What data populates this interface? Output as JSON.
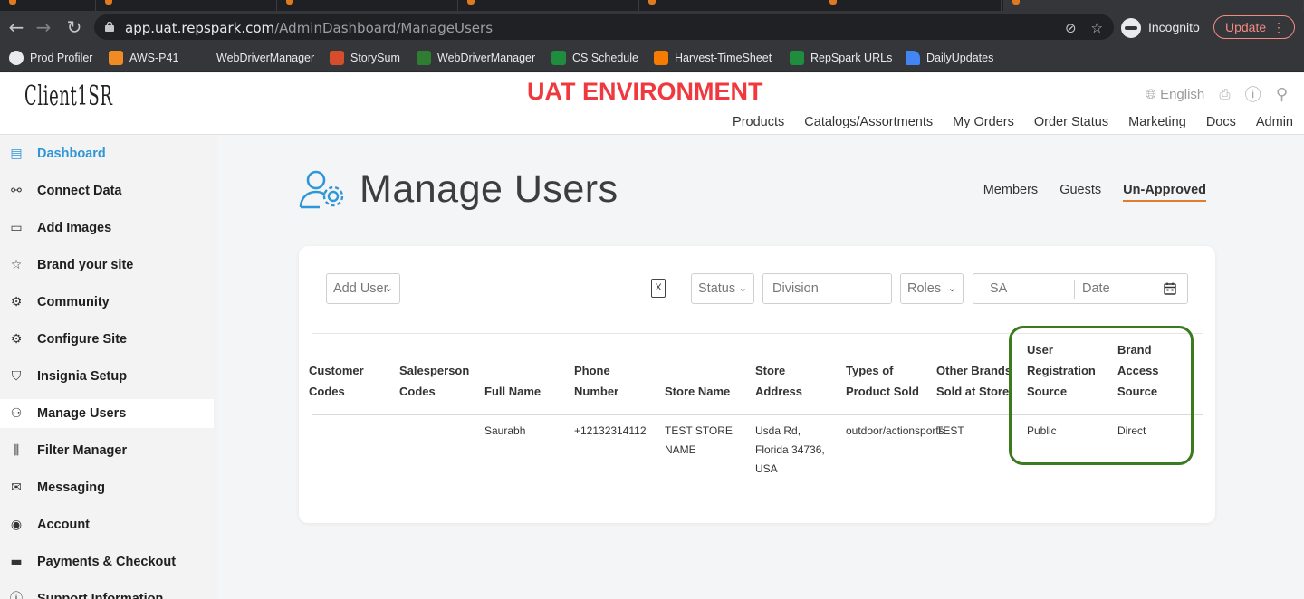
{
  "browser": {
    "url_host": "app.uat.repspark.com",
    "url_path": "/AdminDashboard/ManageUsers",
    "incognito_label": "Incognito",
    "update_label": "Update",
    "bookmarks": [
      {
        "label": "Prod Profiler",
        "color": "#e8eaed"
      },
      {
        "label": "AWS-P41",
        "color": "#f08a24"
      },
      {
        "label": "WebDriverManager",
        "color": "#35363a"
      },
      {
        "label": "StorySum",
        "color": "#d64d2b"
      },
      {
        "label": "WebDriverManager",
        "color": "#2e7d32"
      },
      {
        "label": "CS Schedule",
        "color": "#1e8e3e"
      },
      {
        "label": "Harvest-TimeSheet",
        "color": "#f57c00"
      },
      {
        "label": "RepSpark URLs",
        "color": "#1e8e3e"
      },
      {
        "label": "DailyUpdates",
        "color": "#4285f4"
      }
    ]
  },
  "header": {
    "logo": "Client1SR",
    "env_banner": "UAT ENVIRONMENT",
    "language": "English",
    "nav": [
      "Products",
      "Catalogs/Assortments",
      "My Orders",
      "Order Status",
      "Marketing",
      "Docs",
      "Admin"
    ]
  },
  "sidebar": {
    "items": [
      {
        "label": "Dashboard",
        "icon": "document-icon",
        "glyph": "▤"
      },
      {
        "label": "Connect Data",
        "icon": "link-icon",
        "glyph": "⚯"
      },
      {
        "label": "Add Images",
        "icon": "image-icon",
        "glyph": "▭"
      },
      {
        "label": "Brand your site",
        "icon": "star-icon",
        "glyph": "☆"
      },
      {
        "label": "Community",
        "icon": "gears-icon",
        "glyph": "⚙"
      },
      {
        "label": "Configure Site",
        "icon": "gear-icon",
        "glyph": "⚙"
      },
      {
        "label": "Insignia Setup",
        "icon": "shirt-icon",
        "glyph": "⛉"
      },
      {
        "label": "Manage Users",
        "icon": "users-gear-icon",
        "glyph": "⚇"
      },
      {
        "label": "Filter Manager",
        "icon": "sliders-icon",
        "glyph": "⫼"
      },
      {
        "label": "Messaging",
        "icon": "envelope-icon",
        "glyph": "✉"
      },
      {
        "label": "Account",
        "icon": "user-circle-icon",
        "glyph": "◉"
      },
      {
        "label": "Payments & Checkout",
        "icon": "credit-card-icon",
        "glyph": "▬"
      },
      {
        "label": "Support Information",
        "icon": "info-icon",
        "glyph": "ⓘ"
      }
    ]
  },
  "page": {
    "title": "Manage Users",
    "tabs": [
      "Members",
      "Guests",
      "Un-Approved"
    ],
    "active_tab": "Un-Approved"
  },
  "filters": {
    "add_user": "Add User",
    "status": "Status",
    "division_placeholder": "Division",
    "roles": "Roles",
    "sa_placeholder": "SA",
    "date_placeholder": "Date",
    "excel_icon": "X"
  },
  "table": {
    "headers": [
      [
        "Customer",
        "Codes"
      ],
      [
        "Salesperson",
        "Codes"
      ],
      [
        "Full Name"
      ],
      [
        "Phone",
        "Number"
      ],
      [
        "Store Name"
      ],
      [
        "Store",
        "Address"
      ],
      [
        "Types of",
        "Product Sold"
      ],
      [
        "Other Brands",
        "Sold at Store"
      ],
      [
        "User",
        "Registration",
        "Source"
      ],
      [
        "Brand",
        "Access",
        "Source"
      ]
    ],
    "rows": [
      {
        "customer_codes": "",
        "salesperson_codes": "",
        "full_name": "Saurabh",
        "phone": "+12132314112",
        "store_name": [
          "TEST STORE",
          "NAME"
        ],
        "store_address": [
          "Usda Rd,",
          "Florida 34736,",
          "USA"
        ],
        "product_types": "outdoor/actionsports",
        "other_brands": "TEST",
        "registration_source": "Public",
        "brand_access_source": "Direct"
      }
    ]
  },
  "colors": {
    "accent_blue": "#2f97d8",
    "env_red": "#f0393e",
    "tab_underline": "#e27d2e",
    "highlight_green": "#3b7a1f"
  }
}
